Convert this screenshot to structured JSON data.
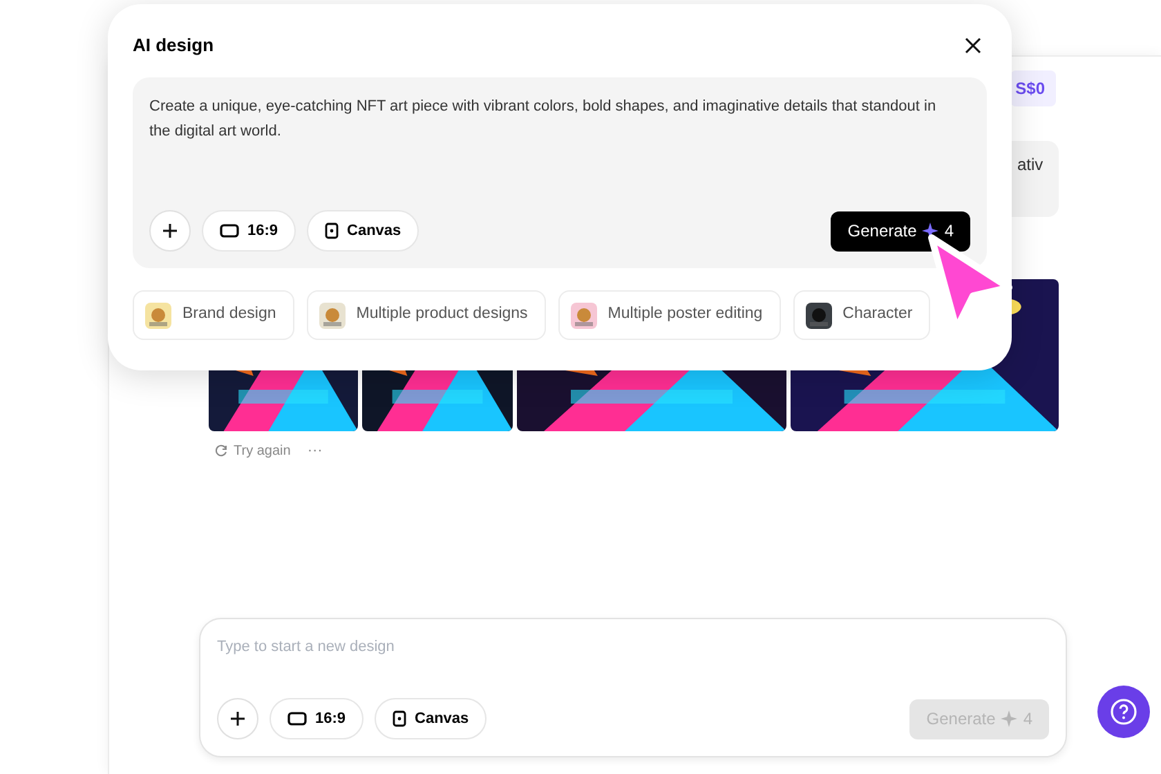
{
  "dialog": {
    "title": "AI design",
    "prompt": "Create a unique, eye-catching NFT art piece with vibrant colors, bold shapes, and imaginative details that standout in the digital art world.",
    "ratio": "16:9",
    "mode": "Canvas",
    "generate": {
      "label": "Generate",
      "cost": "4",
      "disabled": false
    },
    "suggestions": [
      {
        "label": "Brand design"
      },
      {
        "label": "Multiple product designs"
      },
      {
        "label": "Multiple poster editing"
      },
      {
        "label": "Character"
      }
    ]
  },
  "chat": {
    "credits": "S$0",
    "bubble_text": "ativ",
    "retry": "Try again",
    "more": "···"
  },
  "composer": {
    "placeholder": "Type to start a new design",
    "ratio": "16:9",
    "mode": "Canvas",
    "generate": {
      "label": "Generate",
      "cost": "4",
      "disabled": true
    }
  }
}
